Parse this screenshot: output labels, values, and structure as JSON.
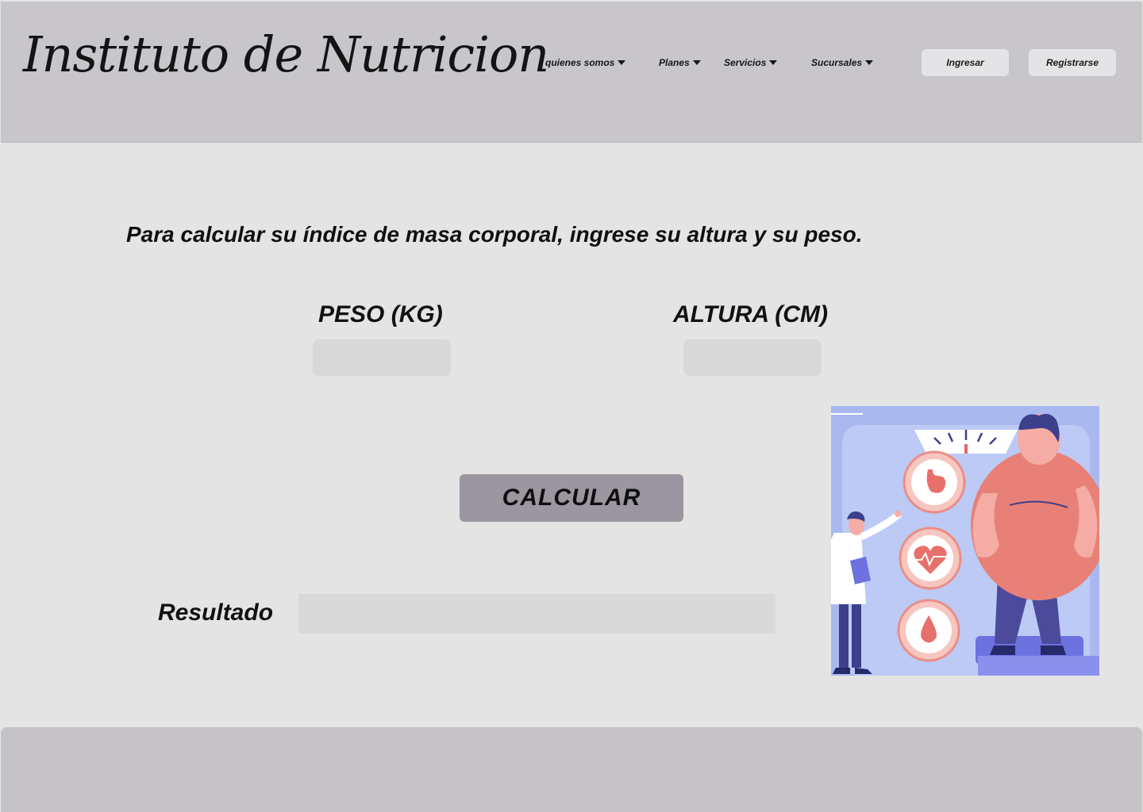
{
  "header": {
    "logo": "Instituto de Nutricion",
    "nav": [
      {
        "label": "quienes somos"
      },
      {
        "label": "Planes"
      },
      {
        "label": "Servicios"
      },
      {
        "label": "Sucursales"
      }
    ],
    "login_label": "Ingresar",
    "register_label": "Registrarse"
  },
  "main": {
    "instruction": "Para calcular su índice de masa corporal, ingrese su altura  y su peso.",
    "weight_label": "PESO  (KG)",
    "weight_value": "",
    "height_label": "ALTURA (CM)",
    "height_value": "",
    "calculate_label": "CALCULAR",
    "result_label": "Resultado",
    "result_value": ""
  },
  "colors": {
    "header_bg": "#c8c6cb",
    "page_bg": "#e4e4e4",
    "button_bg": "#9c96a0",
    "illustration_bg": "#a9b9f0",
    "footer_bg": "#c5c3c8"
  }
}
